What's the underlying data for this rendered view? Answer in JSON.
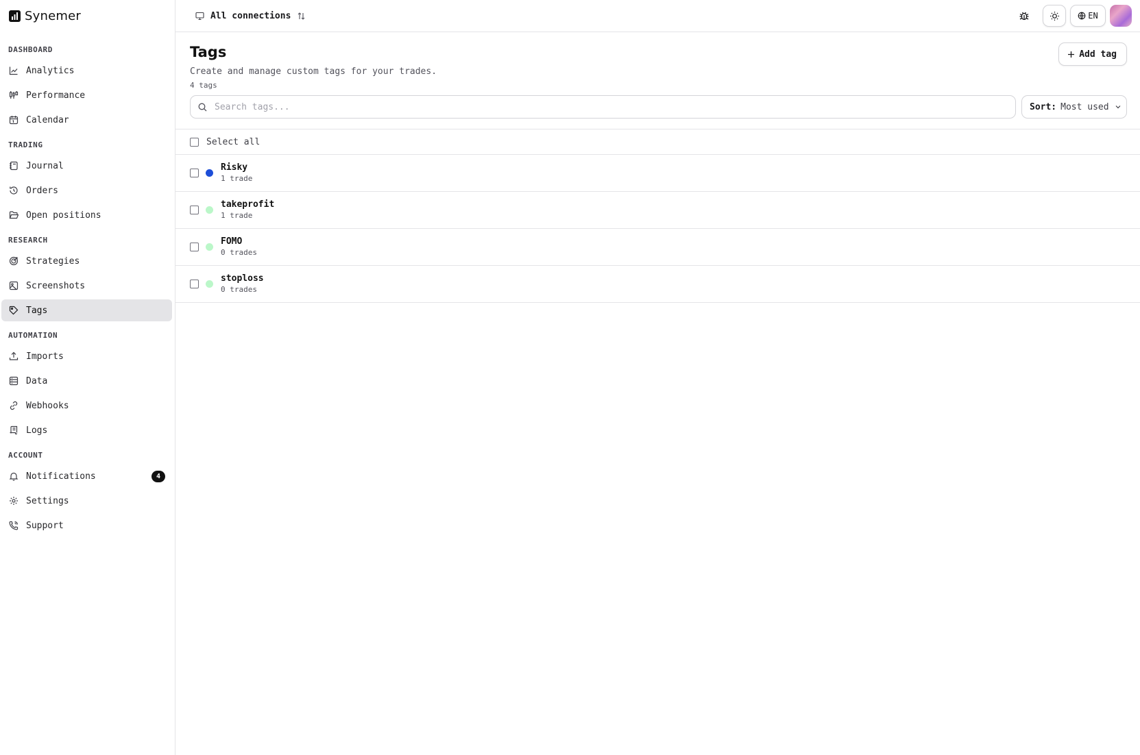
{
  "brand": {
    "name": "Synemer",
    "logo_icon": "bar-chart-logo-icon"
  },
  "sidebar": {
    "sections": [
      {
        "title": "DASHBOARD",
        "items": [
          {
            "label": "Analytics",
            "icon": "line-chart-icon"
          },
          {
            "label": "Performance",
            "icon": "candlestick-icon"
          },
          {
            "label": "Calendar",
            "icon": "calendar-icon"
          }
        ]
      },
      {
        "title": "TRADING",
        "items": [
          {
            "label": "Journal",
            "icon": "notebook-icon"
          },
          {
            "label": "Orders",
            "icon": "history-icon"
          },
          {
            "label": "Open positions",
            "icon": "folder-open-icon"
          }
        ]
      },
      {
        "title": "RESEARCH",
        "items": [
          {
            "label": "Strategies",
            "icon": "target-icon"
          },
          {
            "label": "Screenshots",
            "icon": "image-icon"
          },
          {
            "label": "Tags",
            "icon": "tag-icon",
            "active": true
          }
        ]
      },
      {
        "title": "AUTOMATION",
        "items": [
          {
            "label": "Imports",
            "icon": "upload-icon"
          },
          {
            "label": "Data",
            "icon": "database-icon"
          },
          {
            "label": "Webhooks",
            "icon": "webhook-icon"
          },
          {
            "label": "Logs",
            "icon": "scroll-icon"
          }
        ]
      },
      {
        "title": "ACCOUNT",
        "items": [
          {
            "label": "Notifications",
            "icon": "bell-icon",
            "badge": "4"
          },
          {
            "label": "Settings",
            "icon": "gear-icon"
          },
          {
            "label": "Support",
            "icon": "phone-icon"
          }
        ]
      }
    ]
  },
  "topbar": {
    "connection_label": "All connections",
    "language": "EN"
  },
  "header": {
    "title": "Tags",
    "subtitle": "Create and manage custom tags for your trades.",
    "count": "4 tags",
    "add_label": "Add tag"
  },
  "search": {
    "placeholder": "Search tags..."
  },
  "sort": {
    "label": "Sort:",
    "value": "Most used"
  },
  "list": {
    "select_all": "Select all",
    "tags": [
      {
        "name": "Risky",
        "count": "1 trade",
        "color": "#1d4ed8"
      },
      {
        "name": "takeprofit",
        "count": "1 trade",
        "color": "#bbf7c9"
      },
      {
        "name": "FOMO",
        "count": "0 trades",
        "color": "#bbf7c9"
      },
      {
        "name": "stoploss",
        "count": "0 trades",
        "color": "#bbf7c9"
      }
    ]
  }
}
